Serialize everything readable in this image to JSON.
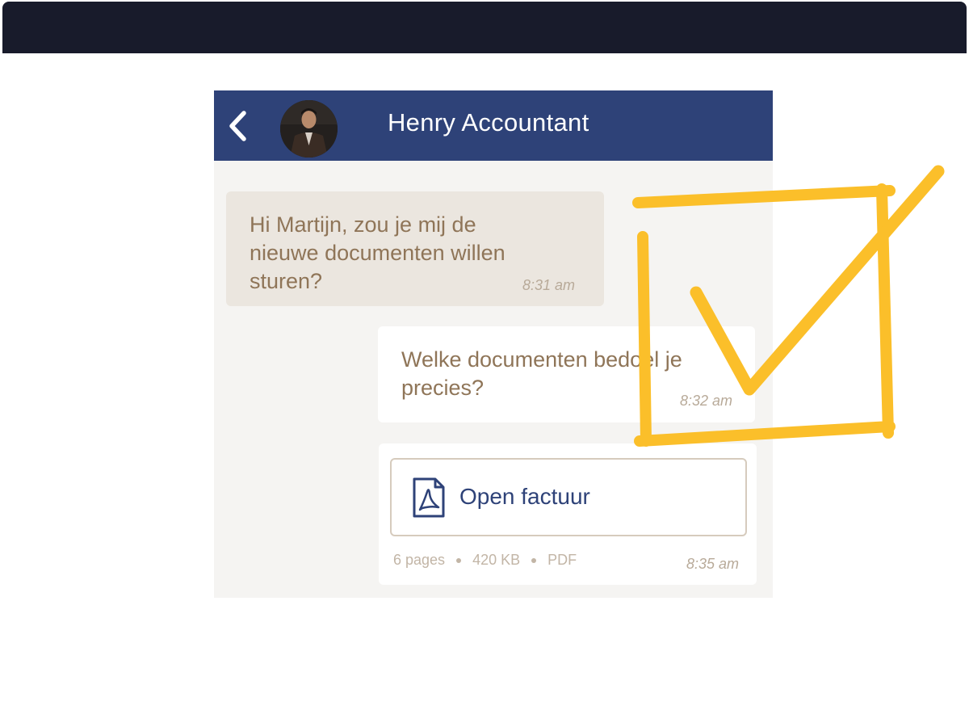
{
  "header": {
    "title": "Henry Accountant"
  },
  "messages": [
    {
      "direction": "incoming",
      "text": [
        "Hi Martijn, zou je mij de",
        "nieuwe documenten willen",
        "sturen?"
      ],
      "time": "8:31 am"
    },
    {
      "direction": "outgoing",
      "text": [
        "Welke documenten bedoel je",
        "precies?"
      ],
      "time": "8:32 am"
    }
  ],
  "attachment": {
    "label": "Open factuur",
    "icon": "pdf-file-icon",
    "pages": "6 pages",
    "size": "420 KB",
    "format": "PDF",
    "time": "8:35 am"
  },
  "colors": {
    "header_bg": "#2e4278",
    "top_bar": "#181b2b",
    "chat_bg": "#f5f4f2",
    "incoming_bubble": "#ebe6df",
    "message_text": "#8f7558",
    "checkmark": "#fbbf2a"
  }
}
